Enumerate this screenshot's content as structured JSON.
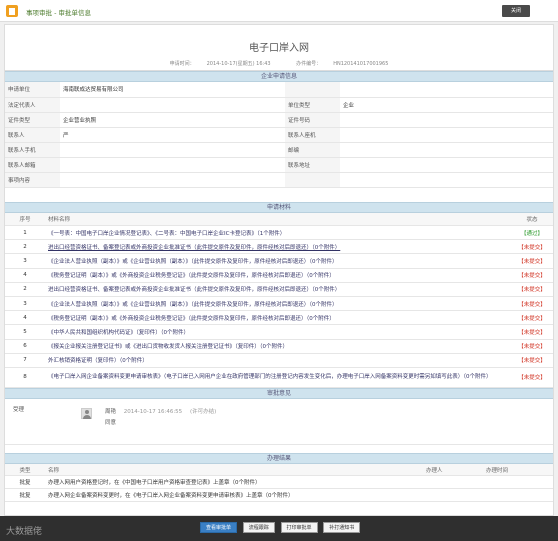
{
  "topbar": {
    "title": "事项审批 - 审批单信息",
    "close_label": "关闭"
  },
  "header": {
    "title": "电子口岸入网",
    "apply_time_label": "申请时间：",
    "apply_time": "2014-10-17(星期五) 16:43",
    "doc_no_label": "办件编号：",
    "doc_no": "HN120141017001965"
  },
  "enterprise": {
    "section_title": "企业申请信息",
    "rows": [
      {
        "l1": "申请单位",
        "v1": "海南联成达贸易有限公司",
        "l2": "",
        "v2": ""
      },
      {
        "l1": "法定代表人",
        "v1": "",
        "l2": "单位类型",
        "v2": "企业"
      },
      {
        "l1": "证件类型",
        "v1": "企业营业执照",
        "l2": "证件号码",
        "v2": ""
      },
      {
        "l1": "联系人",
        "v1": "严",
        "l2": "联系人座机",
        "v2": ""
      },
      {
        "l1": "联系人手机",
        "v1": "",
        "l2": "邮编",
        "v2": ""
      },
      {
        "l1": "联系人邮箱",
        "v1": "",
        "l2": "联系地址",
        "v2": ""
      },
      {
        "l1": "事项内容",
        "v1": "",
        "l2": "",
        "v2": ""
      }
    ]
  },
  "materials": {
    "section_title": "申请材料",
    "col_no": "序号",
    "col_name": "材料名称",
    "col_status": "状态",
    "items": [
      {
        "no": "1",
        "name": "《一号表：中国电子口岸企业情况登记表》、《二号表：中国电子口岸企业IC卡登记表》（1个附件）",
        "status": "【通过】",
        "ok": true
      },
      {
        "no": "2",
        "name": "进出口经营资格证书、备案登记表或外商投资企业批准证书（此件提交原件及复印件，原件经核对后即退还）（0个附件）",
        "status": "【未提交】",
        "ok": false
      },
      {
        "no": "3",
        "name": "《企业法人营业执照（副本）》或《企业营业执照（副本）》（此件提交原件及复印件，原件经核对后即退还）（0个附件）",
        "status": "【未提交】",
        "ok": false
      },
      {
        "no": "4",
        "name": "《税务登记证明（副本）》或《外商投资企业税务登记证》（此件提交原件及复印件，原件经核对后即退还）（0个附件）",
        "status": "【未提交】",
        "ok": false
      },
      {
        "no": "2",
        "name": "进出口经营资格证书、备案登记表或外商投资企业批准证书（此件提交原件及复印件，原件经核对后即退还）（0个附件）",
        "status": "【未提交】",
        "ok": false
      },
      {
        "no": "3",
        "name": "《企业法人营业执照（副本）》或《企业营业执照（副本）》（此件提交原件及复印件，原件经核对后即退还）（0个附件）",
        "status": "【未提交】",
        "ok": false
      },
      {
        "no": "4",
        "name": "《税务登记证明（副本）》或《外商投资企业税务登记证》（此件提交原件及复印件，原件经核对后即退还）（0个附件）",
        "status": "【未提交】",
        "ok": false
      },
      {
        "no": "5",
        "name": "《中华人民共和国组织机构代码证》（复印件）（0个附件）",
        "status": "【未提交】",
        "ok": false
      },
      {
        "no": "6",
        "name": "《报关企业报关注册登记证书》或《进出口货物收发货人报关注册登记证书》（复印件）（0个附件）",
        "status": "【未提交】",
        "ok": false
      },
      {
        "no": "7",
        "name": "外汇核销资格证明（复印件）（0个附件）",
        "status": "【未提交】",
        "ok": false
      },
      {
        "no": "8",
        "name": "《电子口岸入网企业备案资料变更申请审核表》（电子口岸已入网用户企业在政府管理部门的注册登记内容发生变化后，办理电子口岸入网备案资料变更时需另如填写此表）（0个附件）",
        "status": "【未提交】",
        "ok": false
      }
    ]
  },
  "review": {
    "section_title": "审批意见",
    "label": "受理",
    "reviewer": "周艳",
    "time": "2014-10-17 16:46:55",
    "type": "(许可办结)",
    "comment": "同意"
  },
  "results": {
    "section_title": "办理结果",
    "col_type": "类型",
    "col_name": "名称",
    "col_handler": "办理人",
    "col_time": "办理时间",
    "items": [
      {
        "type": "批复",
        "name": "办理入网用户资格登记时，在《中国电子口岸用户资格审查登记表》上盖章（0个附件）",
        "handler": "",
        "time": ""
      },
      {
        "type": "批复",
        "name": "办理入网企业备案资料变更时，在《电子口岸入网企业备案资料变更申请审核表》上盖章（0个附件）",
        "handler": "",
        "time": ""
      }
    ]
  },
  "footer": {
    "buttons": [
      "查看审批单",
      "流程跟踪",
      "打印审批单",
      "补打通知书"
    ],
    "watermark": "大数据佬"
  }
}
